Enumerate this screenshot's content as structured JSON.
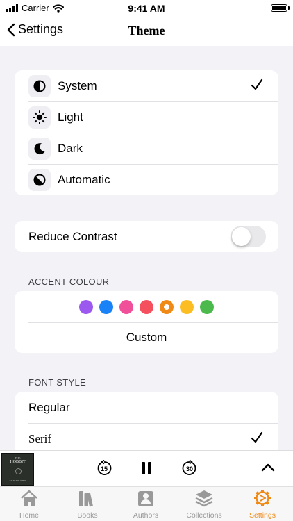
{
  "status_bar": {
    "carrier": "Carrier",
    "time": "9:41 AM"
  },
  "nav": {
    "back_label": "Settings",
    "title": "Theme"
  },
  "theme_options": [
    {
      "label": "System",
      "icon": "half-circle-icon",
      "selected": true
    },
    {
      "label": "Light",
      "icon": "sun-icon",
      "selected": false
    },
    {
      "label": "Dark",
      "icon": "moon-icon",
      "selected": false
    },
    {
      "label": "Automatic",
      "icon": "auto-contrast-icon",
      "selected": false
    }
  ],
  "reduce_contrast": {
    "label": "Reduce Contrast",
    "enabled": false
  },
  "accent": {
    "header": "ACCENT COLOUR",
    "colors": [
      "#9b59f0",
      "#1a82f7",
      "#f0509a",
      "#f4505e",
      "#f08a16",
      "#fbbd22",
      "#4cb94c"
    ],
    "selected_color": "#f08a16",
    "custom_label": "Custom"
  },
  "font_style": {
    "header": "FONT STYLE",
    "options": [
      {
        "label": "Regular",
        "selected": false
      },
      {
        "label": "Serif",
        "selected": true
      }
    ]
  },
  "player": {
    "cover_top": "THE",
    "cover_title": "HOBBIT",
    "cover_author": "J.R.R. TOLKIEN",
    "skip_back": "15",
    "skip_forward": "30"
  },
  "tabs": [
    {
      "label": "Home",
      "icon": "home-icon",
      "active": false
    },
    {
      "label": "Books",
      "icon": "books-icon",
      "active": false
    },
    {
      "label": "Authors",
      "icon": "authors-icon",
      "active": false
    },
    {
      "label": "Collections",
      "icon": "collections-icon",
      "active": false
    },
    {
      "label": "Settings",
      "icon": "settings-gear-icon",
      "active": true
    }
  ],
  "colors": {
    "accent": "#f08a16",
    "tab_inactive": "#999999",
    "background": "#f2f2f7"
  }
}
